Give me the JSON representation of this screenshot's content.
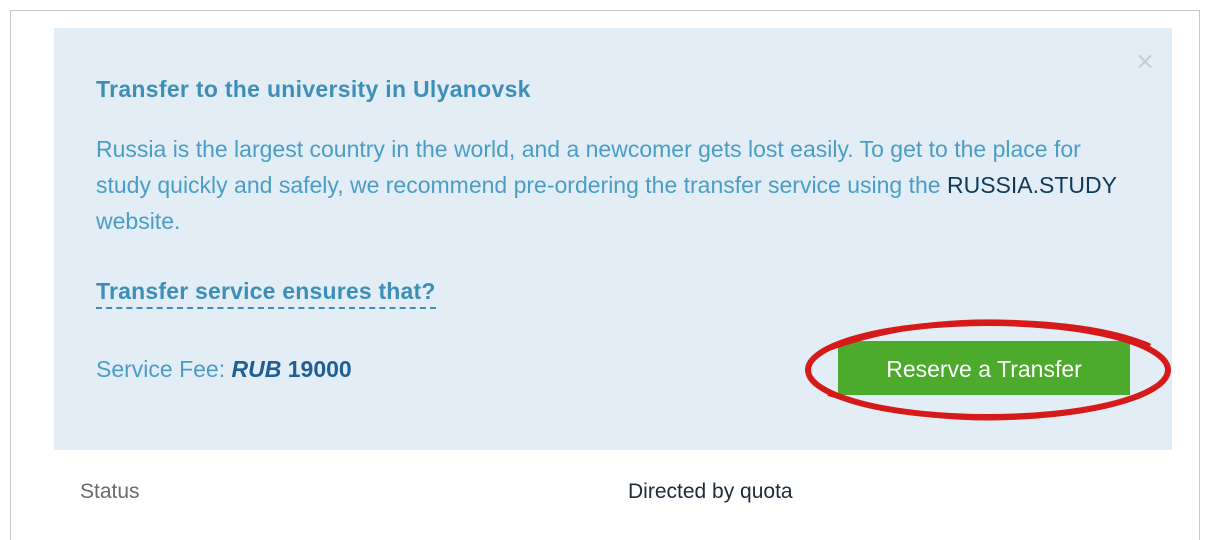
{
  "transfer_card": {
    "title": "Transfer to the university in Ulyanovsk",
    "description_before": "Russia is the largest country in the world, and a newcomer gets lost easily. To get to the place for study quickly and safely, we recommend pre-ordering the transfer service using the ",
    "description_brand": "RUSSIA.STUDY",
    "description_after": " website.",
    "faq_link": "Transfer service ensures that?",
    "fee_label": "Service Fee: ",
    "fee_currency": "RUB",
    "fee_amount": "19000",
    "reserve_button": "Reserve a Transfer",
    "close_icon": "×"
  },
  "details": {
    "status_label": "Status",
    "status_value": "Directed by quota"
  },
  "colors": {
    "panel_background": "#e3edf5",
    "accent_text": "#3e8fb8",
    "button_green": "#4caa2c",
    "highlight_circle": "#d61a1a"
  }
}
